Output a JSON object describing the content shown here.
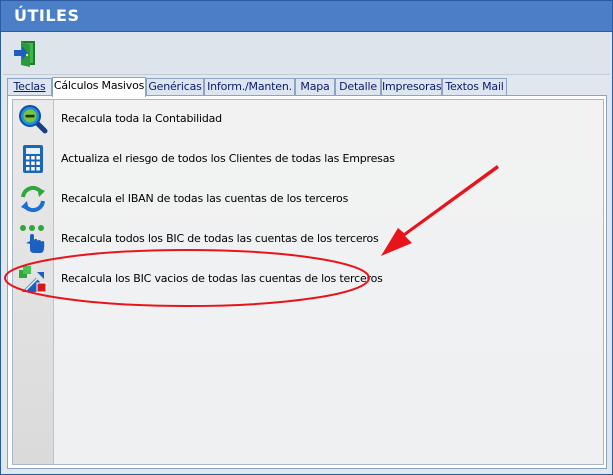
{
  "window": {
    "title": "ÚTILES"
  },
  "toolbar": {
    "exit_icon": "exit-door-icon"
  },
  "tabs": [
    {
      "label": "Teclas",
      "active": false
    },
    {
      "label": "Cálculos Masivos",
      "active": true
    },
    {
      "label": "Genéricas",
      "active": false
    },
    {
      "label": "Inform./Manten.",
      "active": false
    },
    {
      "label": "Mapa",
      "active": false
    },
    {
      "label": "Detalle",
      "active": false
    },
    {
      "label": "Impresoras",
      "active": false
    },
    {
      "label": "Textos Mail",
      "active": false
    }
  ],
  "actions": [
    {
      "label": "Recalcula toda la Contabilidad",
      "icon": "magnifier-minus-icon"
    },
    {
      "label": "Actualiza el riesgo de todos los Clientes de todas las Empresas",
      "icon": "calculator-icon"
    },
    {
      "label": "Recalcula el IBAN de todas las cuentas de los terceros",
      "icon": "refresh-arrows-icon"
    },
    {
      "label": "Recalcula todos los BIC de todas las cuentas de los terceros",
      "icon": "hand-pointer-icon"
    },
    {
      "label": "Recalcula los BIC vacios de todas las cuentas de los terceros",
      "icon": "bic-empty-icon"
    }
  ],
  "annotation": {
    "color": "#e8141c",
    "highlighted_action": "Recalcula los BIC vacios de todas las cuentas de los terceros"
  }
}
